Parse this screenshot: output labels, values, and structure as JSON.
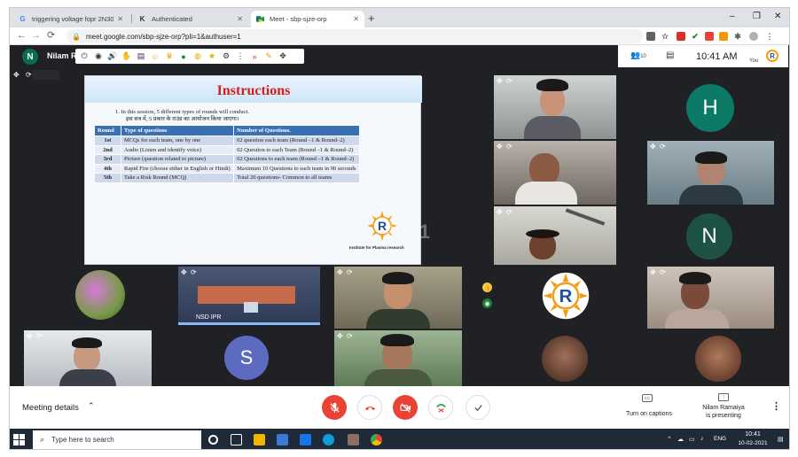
{
  "browser": {
    "tabs": [
      {
        "title": "triggering voltage fopr 2N3055 t",
        "favicon": "G"
      },
      {
        "title": "Authenticated",
        "favicon": "K"
      },
      {
        "title": "Meet - sbp-sjze-orp",
        "favicon": "M"
      }
    ],
    "new_tab": "+",
    "url": "meet.google.com/sbp-sjze-orp?pli=1&authuser=1",
    "window_controls": {
      "minimize": "–",
      "restore": "❐",
      "close": "✕"
    }
  },
  "meet": {
    "presenter_avatar_letter": "N",
    "presenter_name": "Nilam R",
    "clock": "10:41 AM",
    "self_label": "You",
    "participants_count": "10",
    "slide": {
      "title": "Instructions",
      "point_en": "1.    In this session, 5 different types of rounds will conduct.",
      "point_hi": "इस सत्र में, 5 प्रकार के राउंड का आयोजन किया जाएगा।",
      "table_headers": [
        "Round",
        "Type of questions",
        "Number of Questions."
      ],
      "rows": [
        {
          "round": "1st",
          "type": "MCQs for each team, one by one",
          "number": "02 question each team (Round –1 & Round–2)"
        },
        {
          "round": "2nd",
          "type": "Audio (Listen and identify voice)",
          "number": "02 Question to each Team (Round –1 & Round–2)"
        },
        {
          "round": "3rd",
          "type": "Picture (question related to picture)",
          "number": "02 Questions to each team (Round –1 & Round–2)"
        },
        {
          "round": "4th",
          "type": "Rapid Fire (choose either in English or Hindi)",
          "number": "Maximum 10 Questions to each team in 90 seconds"
        },
        {
          "round": "5th",
          "type": "Take a Risk Round (MCQ)",
          "number": "Total 20 questions- Common to all teams"
        }
      ],
      "institute": "Institute for Plasma research"
    },
    "watermark": "2021",
    "tiles": {
      "h_letter": "H",
      "n_letter": "N",
      "s_letter": "S",
      "nsd_label": "NSD IPR"
    }
  },
  "controls": {
    "meeting_details": "Meeting details",
    "captions": "Turn on captions",
    "captions_badge": "CC",
    "presenter_line1": "Nilam Ramaiya",
    "presenter_line2": "is presenting"
  },
  "taskbar": {
    "search_placeholder": "Type here to search",
    "time": "10:41",
    "date": "10-02-2021",
    "lang": "ENG"
  },
  "colors": {
    "meet_bg": "#202124",
    "tile_bg": "#3c4043",
    "mic_off_red": "#ea4335",
    "h_avatar": "#0b7a66",
    "n_avatar": "#1e5245",
    "s_avatar": "#5c6bc0",
    "slide_title_red": "#d41e1e",
    "table_header_blue": "#3b6fb4"
  },
  "icons": [
    "back-icon",
    "forward-icon",
    "reload-icon",
    "lock-icon",
    "pin-icon",
    "rotate-icon",
    "people-icon",
    "chat-icon",
    "mic-off-icon",
    "hangup-icon",
    "camera-off-icon",
    "present-icon",
    "more-icon",
    "windows-start-icon",
    "search-icon"
  ]
}
